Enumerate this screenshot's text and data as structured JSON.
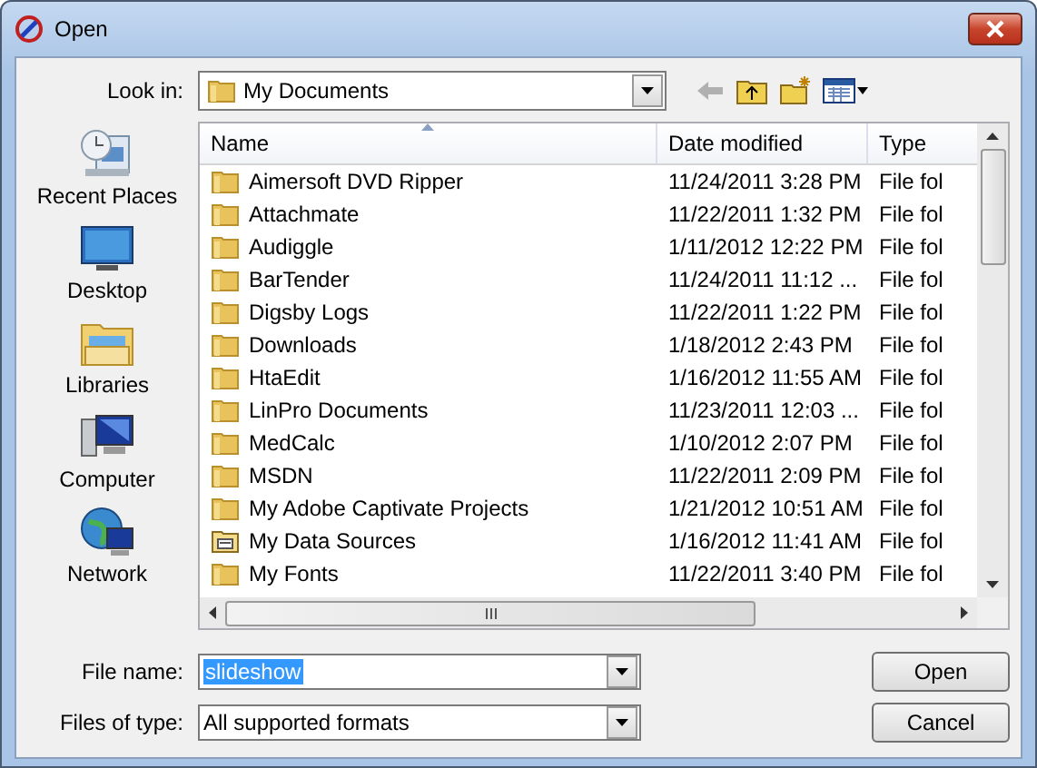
{
  "window": {
    "title": "Open"
  },
  "look_in": {
    "label": "Look in:",
    "value": "My Documents"
  },
  "places": [
    {
      "label": "Recent Places",
      "kind": "recent"
    },
    {
      "label": "Desktop",
      "kind": "desktop"
    },
    {
      "label": "Libraries",
      "kind": "libraries"
    },
    {
      "label": "Computer",
      "kind": "computer"
    },
    {
      "label": "Network",
      "kind": "network"
    }
  ],
  "table": {
    "columns": [
      "Name",
      "Date modified",
      "Type"
    ],
    "rows": [
      {
        "name": "Aimersoft DVD Ripper",
        "date": "11/24/2011 3:28 PM",
        "type": "File fol",
        "kind": "folder"
      },
      {
        "name": "Attachmate",
        "date": "11/22/2011 1:32 PM",
        "type": "File fol",
        "kind": "folder"
      },
      {
        "name": "Audiggle",
        "date": "1/11/2012 12:22 PM",
        "type": "File fol",
        "kind": "folder"
      },
      {
        "name": "BarTender",
        "date": "11/24/2011 11:12 ...",
        "type": "File fol",
        "kind": "folder"
      },
      {
        "name": "Digsby Logs",
        "date": "11/22/2011 1:22 PM",
        "type": "File fol",
        "kind": "folder"
      },
      {
        "name": "Downloads",
        "date": "1/18/2012 2:43 PM",
        "type": "File fol",
        "kind": "folder"
      },
      {
        "name": "HtaEdit",
        "date": "1/16/2012 11:55 AM",
        "type": "File fol",
        "kind": "folder"
      },
      {
        "name": "LinPro Documents",
        "date": "11/23/2011 12:03 ...",
        "type": "File fol",
        "kind": "folder"
      },
      {
        "name": "MedCalc",
        "date": "1/10/2012 2:07 PM",
        "type": "File fol",
        "kind": "folder"
      },
      {
        "name": "MSDN",
        "date": "11/22/2011 2:09 PM",
        "type": "File fol",
        "kind": "folder"
      },
      {
        "name": "My Adobe Captivate Projects",
        "date": "1/21/2012 10:51 AM",
        "type": "File fol",
        "kind": "folder"
      },
      {
        "name": "My Data Sources",
        "date": "1/16/2012 11:41 AM",
        "type": "File fol",
        "kind": "datasource"
      },
      {
        "name": "My Fonts",
        "date": "11/22/2011 3:40 PM",
        "type": "File fol",
        "kind": "folder"
      }
    ]
  },
  "file_name": {
    "label": "File name:",
    "value": "slideshow"
  },
  "file_type": {
    "label": "Files of type:",
    "value": "All supported formats"
  },
  "buttons": [
    "Open",
    "Cancel"
  ]
}
